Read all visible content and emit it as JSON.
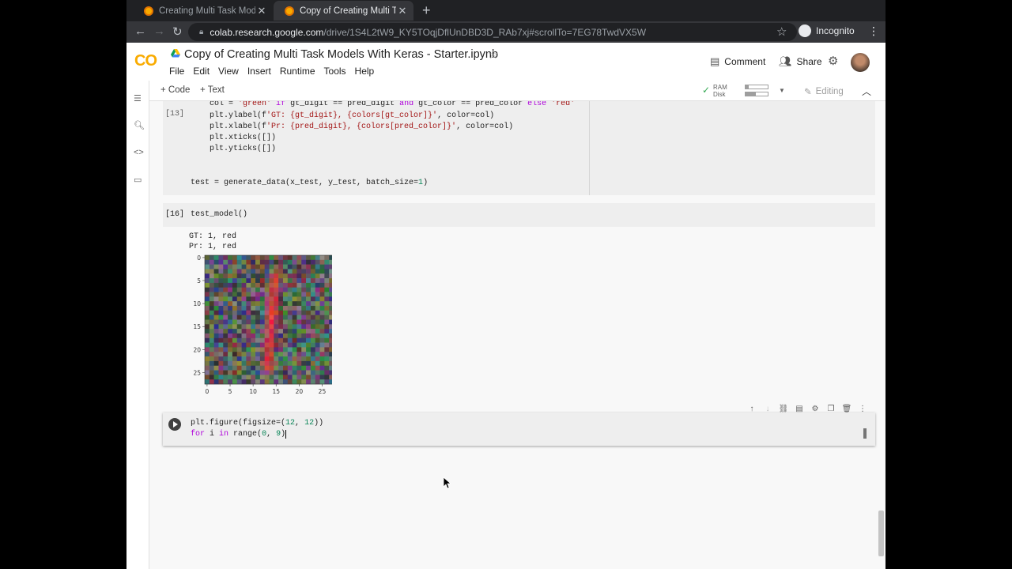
{
  "browser": {
    "tabs": [
      {
        "title": "Creating Multi Task Models",
        "active": false
      },
      {
        "title": "Copy of Creating Multi Task",
        "active": true
      }
    ],
    "new_tab": "+",
    "url_host": "colab.research.google.com",
    "url_path": "/drive/1S4L2tW9_KY5TOqjDflUnDBD3D_RAb7xj#scrollTo=7EG78TwdVX5W",
    "incognito_label": "Incognito"
  },
  "colab": {
    "logo": "CO",
    "notebook_title": "Copy of Creating Multi Task Models With Keras - Starter.ipynb",
    "menu": [
      "File",
      "Edit",
      "View",
      "Insert",
      "Runtime",
      "Tools",
      "Help"
    ],
    "comment_label": "Comment",
    "share_label": "Share",
    "add_code_label": "+ Code",
    "add_text_label": "+ Text",
    "ram_label": "RAM",
    "disk_label": "Disk",
    "ram_usage": 0.15,
    "disk_usage": 0.45,
    "editing_label": "Editing"
  },
  "cells": {
    "cell1": {
      "exec_count": "[13]",
      "lines": [
        "    col = 'green' if gt_digit == pred_digit and gt_color == pred_color else 'red'",
        "    plt.ylabel(f'GT: {gt_digit}, {colors[gt_color]}', color=col)",
        "    plt.xlabel(f'Pr: {pred_digit}, {colors[pred_color]}', color=col)",
        "    plt.xticks([])",
        "    plt.yticks([])",
        "",
        "",
        "test = generate_data(x_test, y_test, batch_size=1)"
      ]
    },
    "cell2": {
      "exec_count": "[16]",
      "code": "test_model()",
      "output_lines": [
        "GT: 1, red",
        "Pr: 1, red"
      ]
    },
    "cell3": {
      "line1": "plt.figure(figsize=(12, 12))",
      "line2": "for i in range(0, 9)"
    }
  },
  "chart_data": {
    "type": "heatmap",
    "title": "",
    "xlabel": "",
    "ylabel": "",
    "x_ticks": [
      "0",
      "5",
      "10",
      "15",
      "20",
      "25"
    ],
    "y_ticks": [
      "0",
      "5",
      "10",
      "15",
      "20",
      "25"
    ],
    "xlim": [
      0,
      27
    ],
    "ylim": [
      0,
      27
    ],
    "grid_size": 28,
    "description_values": "noisy multicolor pixels with a red vertical digit '1' stroke around column 14"
  }
}
